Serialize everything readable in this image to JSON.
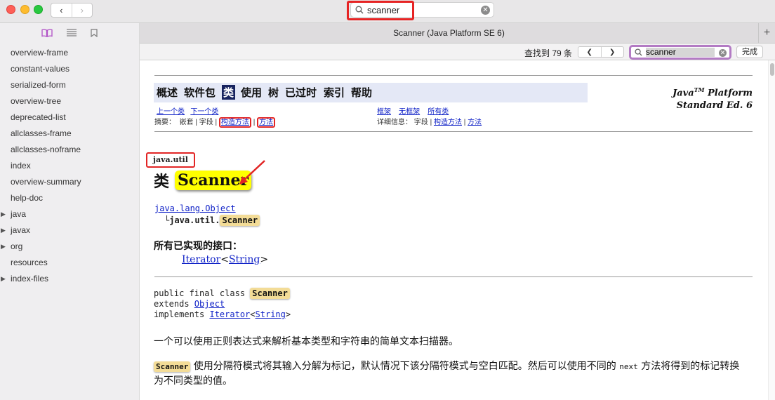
{
  "toolbar": {
    "search_value": "scanner",
    "back_glyph": "‹",
    "forward_glyph": "›"
  },
  "sidebar": {
    "items": [
      {
        "label": "overview-frame",
        "expandable": false
      },
      {
        "label": "constant-values",
        "expandable": false
      },
      {
        "label": "serialized-form",
        "expandable": false
      },
      {
        "label": "overview-tree",
        "expandable": false
      },
      {
        "label": "deprecated-list",
        "expandable": false
      },
      {
        "label": "allclasses-frame",
        "expandable": false
      },
      {
        "label": "allclasses-noframe",
        "expandable": false
      },
      {
        "label": "index",
        "expandable": false
      },
      {
        "label": "overview-summary",
        "expandable": false
      },
      {
        "label": "help-doc",
        "expandable": false
      },
      {
        "label": "java",
        "expandable": true
      },
      {
        "label": "javax",
        "expandable": true
      },
      {
        "label": "org",
        "expandable": true
      },
      {
        "label": "resources",
        "expandable": false
      },
      {
        "label": "index-files",
        "expandable": true
      }
    ]
  },
  "tab": {
    "title": "Scanner (Java Platform SE 6)"
  },
  "find": {
    "count_label": "查找到 79 条",
    "query": "scanner",
    "done_label": "完成"
  },
  "doc": {
    "nav": [
      "概述",
      "软件包",
      "类",
      "使用",
      "树",
      "已过时",
      "索引",
      "帮助"
    ],
    "nav_current": "类",
    "brand_line1": "Java",
    "brand_tm": "TM",
    "brand_line1_rest": " Platform",
    "brand_line2": "Standard Ed. 6",
    "prev_class": "上一个类",
    "next_class": "下一个类",
    "frames": "框架",
    "no_frames": "无框架",
    "all_classes": "所有类",
    "summary_label": "摘要：",
    "summary_nested": "嵌套",
    "summary_field": "字段",
    "summary_constructor": "构造方法",
    "summary_method": "方法",
    "detail_label": "详细信息：",
    "detail_field": "字段",
    "detail_constructor": "构造方法",
    "detail_method": "方法",
    "sep": "|",
    "package_name": "java.util",
    "class_prefix": "类",
    "class_name": "Scanner",
    "tree_root": "java.lang.Object",
    "tree_branch": "└",
    "tree_child_prefix": "java.util.",
    "tree_child_name": "Scanner",
    "interfaces_heading": "所有已实现的接口：",
    "iface_name": "Iterator",
    "iface_lt": "<",
    "iface_type": "String",
    "iface_gt": ">",
    "decl_line1": "public final class ",
    "decl_class": "Scanner",
    "decl_extends": "extends ",
    "decl_extends_type": "Object",
    "decl_implements": "implements ",
    "decl_impl_type": "Iterator",
    "decl_lt": "<",
    "decl_impl_arg": "String",
    "decl_gt": ">",
    "description": "一个可以使用正则表达式来解析基本类型和字符串的简单文本扫描器。",
    "para_word": "Scanner",
    "para_a": " 使用分隔符模式将其输入分解为标记，默认情况下该分隔符模式与空白匹配。然后可以使用不同的 ",
    "para_code": "next",
    "para_b": " 方法将得到的标记转换为不同类型的值。"
  },
  "colors": {
    "highlight": "#ffff00",
    "find_highlight": "#f3dc97",
    "annotation_red": "#e22525",
    "nav_current_bg": "#18245f"
  },
  "icons": [
    "book-icon",
    "list-icon",
    "bookmark-icon",
    "search-icon",
    "clear-icon",
    "arrow-annotation"
  ]
}
